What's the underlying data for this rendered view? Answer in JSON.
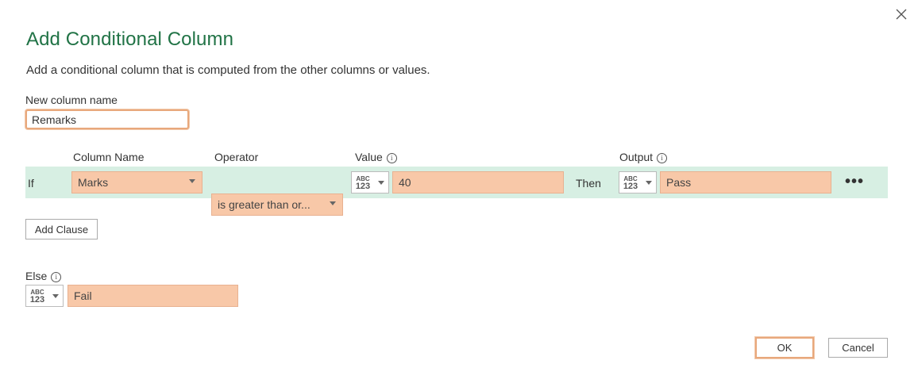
{
  "dialog": {
    "title": "Add Conditional Column",
    "subtitle": "Add a conditional column that is computed from the other columns or values.",
    "close_icon": "close-icon"
  },
  "new_column": {
    "label": "New column name",
    "value": "Remarks"
  },
  "headers": {
    "column_name": "Column Name",
    "operator": "Operator",
    "value": "Value",
    "output": "Output"
  },
  "clause": {
    "if_label": "If",
    "column": "Marks",
    "operator": "is greater than or...",
    "value_type_top": "ABC",
    "value_type_bottom": "123",
    "value": "40",
    "then_label": "Then",
    "output_type_top": "ABC",
    "output_type_bottom": "123",
    "output": "Pass",
    "more": "•••"
  },
  "add_clause_label": "Add Clause",
  "else": {
    "label": "Else",
    "type_top": "ABC",
    "type_bottom": "123",
    "value": "Fail"
  },
  "buttons": {
    "ok": "OK",
    "cancel": "Cancel"
  },
  "colors": {
    "accent_green": "#217346",
    "row_background": "#d7efe3",
    "field_highlight": "#f8c8a8",
    "focus_border": "#e8a87c"
  }
}
